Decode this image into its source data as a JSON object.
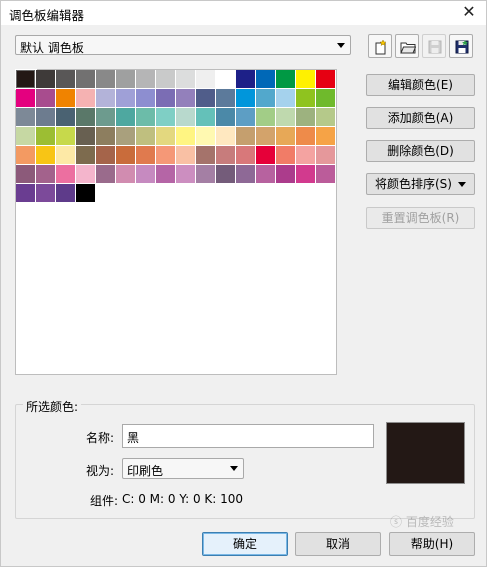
{
  "window": {
    "title": "调色板编辑器",
    "close_glyph": "✕"
  },
  "palette_select": {
    "value": "默认 调色板"
  },
  "toolbar": [
    {
      "name": "new-palette-button",
      "icon": "new-file-icon",
      "enabled": true
    },
    {
      "name": "open-palette-button",
      "icon": "folder-icon",
      "enabled": true
    },
    {
      "name": "save-palette-button",
      "icon": "save-icon",
      "enabled": false
    },
    {
      "name": "save-as-palette-button",
      "icon": "save-as-icon",
      "enabled": true
    }
  ],
  "swatches": [
    "#231815",
    "#3e3a39",
    "#595757",
    "#727171",
    "#898989",
    "#9fa0a0",
    "#b5b5b6",
    "#c9caca",
    "#dcdddd",
    "#efefef",
    "#ffffff",
    "#1d2088",
    "#0068b7",
    "#009944",
    "#fff100",
    "#e60012",
    "#e4007f",
    "#a84c8e",
    "#f08300",
    "#f5b2b2",
    "#b3b3d9",
    "#9fa0d7",
    "#8d8ed0",
    "#7b6db4",
    "#9380bb",
    "#505d8a",
    "#5c7a9b",
    "#0096db",
    "#52a8cc",
    "#a5d2ed",
    "#8fc31f",
    "#6fba2c",
    "#7d8997",
    "#6d7c8f",
    "#4a6272",
    "#5a7869",
    "#6d9b8e",
    "#4ea8a0",
    "#6cbca9",
    "#7fcfc5",
    "#b8d9cd",
    "#64c1b9",
    "#4b89a8",
    "#5d9ec4",
    "#a2cd87",
    "#bfd9ae",
    "#9db27f",
    "#b5c98a",
    "#c6d8a3",
    "#9cbe33",
    "#c7d94b",
    "#686051",
    "#8d7e5f",
    "#a9a07d",
    "#bfbf7f",
    "#e3d87f",
    "#fff582",
    "#fff9b1",
    "#ffe8c0",
    "#c59f6e",
    "#d3a36b",
    "#e7a857",
    "#ee8b4a",
    "#f6a346",
    "#f39a62",
    "#f8c515",
    "#fde9a6",
    "#7d6b4e",
    "#a5644a",
    "#c96c3b",
    "#e07a4e",
    "#f59877",
    "#f9c0a4",
    "#a5736b",
    "#c77c7c",
    "#d8787a",
    "#e60039",
    "#f17c67",
    "#f4a3a1",
    "#e5989b",
    "#8c5a7a",
    "#a3628c",
    "#ec6fa0",
    "#f4b5cc",
    "#9a6b8c",
    "#d18cb0",
    "#c68ac0",
    "#b565a6",
    "#cc8ec0",
    "#a47fa4",
    "#745c7a",
    "#8e6996",
    "#b7629f",
    "#ac3c8c",
    "#d23a8e",
    "#bb5c9a",
    "#6a3d91",
    "#7c4a9a",
    "#5e3b8a",
    "#000000"
  ],
  "selected_swatch_index": 0,
  "side_buttons": {
    "edit": "编辑颜色(E)",
    "add": "添加颜色(A)",
    "delete": "删除颜色(D)",
    "sort": "将颜色排序(S)",
    "reset": "重置调色板(R)"
  },
  "selected_color": {
    "group_label": "所选颜色:",
    "name_label": "名称:",
    "name_value": "黑",
    "view_label": "视为:",
    "view_value": "印刷色",
    "components_label": "组件:",
    "components_value": "C: 0 M: 0 Y: 0 K: 100",
    "preview_color": "#231815"
  },
  "footer": {
    "ok": "确定",
    "cancel": "取消",
    "help": "帮助(H)"
  },
  "watermark": "ⓢ 百度经验"
}
